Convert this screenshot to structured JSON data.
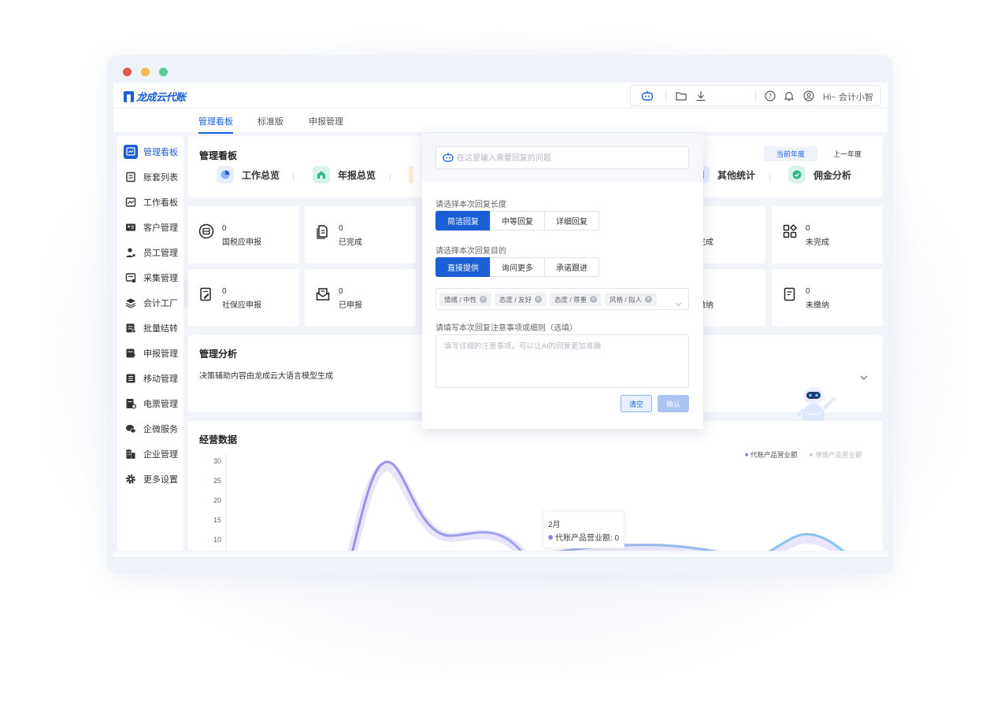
{
  "window": {
    "dot_colors": [
      "#e8584d",
      "#f1bc4e",
      "#5cc99c"
    ]
  },
  "brand": {
    "name": "龙成云代账",
    "color": "#1b5fd6"
  },
  "topbar": {
    "greeting": "Hi~ 会计小智",
    "icons": [
      "robot-chat-icon",
      "folder-icon",
      "download-icon",
      "help-icon",
      "bell-icon",
      "user-icon"
    ]
  },
  "tabs": [
    "管理看板",
    "标准版",
    "申报管理"
  ],
  "sidebar": {
    "items": [
      {
        "label": "管理看板",
        "icon": "dashboard-icon"
      },
      {
        "label": "账套列表",
        "icon": "book-icon"
      },
      {
        "label": "工作看板",
        "icon": "chart-icon"
      },
      {
        "label": "客户管理",
        "icon": "contact-card-icon"
      },
      {
        "label": "员工管理",
        "icon": "person-gear-icon"
      },
      {
        "label": "采集管理",
        "icon": "collect-icon"
      },
      {
        "label": "会计工厂",
        "icon": "layers-icon"
      },
      {
        "label": "批量结转",
        "icon": "batch-icon"
      },
      {
        "label": "申报管理",
        "icon": "declare-icon"
      },
      {
        "label": "移动管理",
        "icon": "list-icon"
      },
      {
        "label": "电票管理",
        "icon": "invoice-icon"
      },
      {
        "label": "企微服务",
        "icon": "wechat-icon"
      },
      {
        "label": "企业管理",
        "icon": "building-icon"
      },
      {
        "label": "更多设置",
        "icon": "settings-icon"
      }
    ]
  },
  "overview": {
    "title": "管理看板",
    "year_current": "当前年度",
    "year_last": "上一年度",
    "kpis": [
      "工作总览",
      "年报总览",
      "其他统计",
      "佣金分析"
    ]
  },
  "stats": {
    "row1": [
      {
        "value": "0",
        "label": "国税应申报"
      },
      {
        "value": "0",
        "label": "已完成"
      },
      {
        "label": "完成"
      },
      {
        "value": "0",
        "label": "未完成"
      }
    ],
    "row2": [
      {
        "value": "0",
        "label": "社保应申报"
      },
      {
        "value": "0",
        "label": "已申报"
      },
      {
        "label": "缴纳"
      },
      {
        "value": "0",
        "label": "未缴纳"
      }
    ]
  },
  "analysis": {
    "title": "管理分析",
    "subtitle": "决策辅助内容由龙成云大语言模型生成"
  },
  "popup": {
    "search_placeholder": "在这里输入需要回复的问题",
    "length_label": "请选择本次回复长度",
    "length_options": [
      "简洁回复",
      "中等回复",
      "详细回复"
    ],
    "purpose_label": "请选择本次回复目的",
    "purpose_options": [
      "直接提供",
      "询问更多",
      "承诺跟进"
    ],
    "tags": [
      "情绪 / 中性",
      "态度 / 友好",
      "态度 / 尊重",
      "风格 / 拟人"
    ],
    "notes_label": "请填写本次回复注意事项或细则（选填）",
    "notes_placeholder": "填写详细的注意事项，可以让AI的回复更加准确",
    "clear_label": "清空",
    "confirm_label": "确认"
  },
  "business": {
    "title": "经营数据",
    "tooltip_month": "2月",
    "tooltip_series": "代账产品营业额: 0"
  },
  "chart_data": {
    "type": "line",
    "y_ticks": [
      30,
      25,
      20,
      15,
      10
    ],
    "series": [
      {
        "name": "代账产品营业额",
        "color": "#7b8de0"
      },
      {
        "name": "增值产品营业额",
        "color": "#c8ccd4"
      }
    ]
  }
}
